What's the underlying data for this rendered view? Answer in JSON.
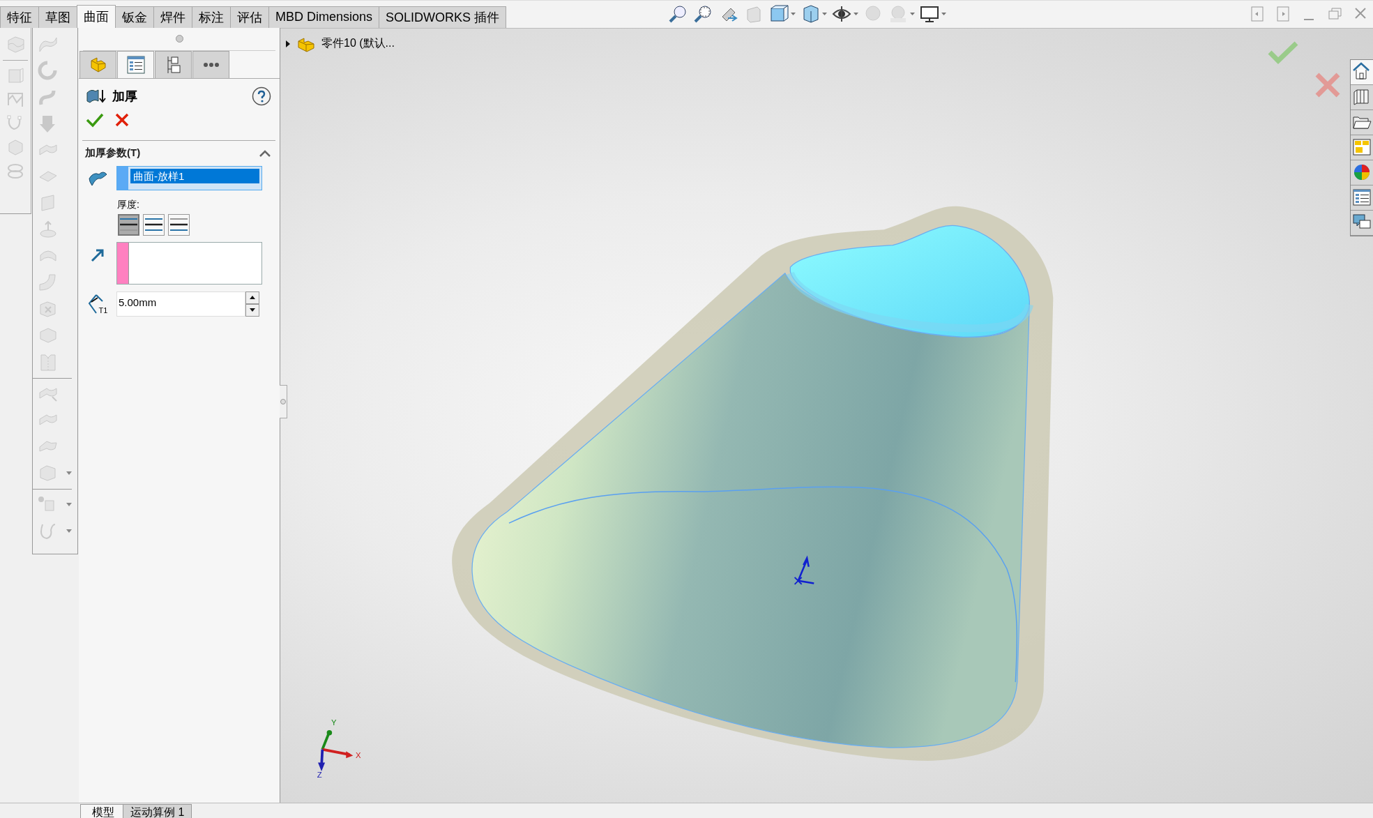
{
  "command_tabs": [
    {
      "label": "特征",
      "selected": false
    },
    {
      "label": "草图",
      "selected": false
    },
    {
      "label": "曲面",
      "selected": true
    },
    {
      "label": "钣金",
      "selected": false
    },
    {
      "label": "焊件",
      "selected": false
    },
    {
      "label": "标注",
      "selected": false
    },
    {
      "label": "评估",
      "selected": false
    },
    {
      "label": "MBD Dimensions",
      "selected": false
    },
    {
      "label": "SOLIDWORKS 插件",
      "selected": false
    }
  ],
  "property_manager": {
    "tabs": [
      {
        "kind": "feature",
        "selected": false
      },
      {
        "kind": "property",
        "selected": true
      },
      {
        "kind": "configuration",
        "selected": false
      },
      {
        "kind": "more",
        "selected": false
      }
    ],
    "title": "加厚",
    "section": {
      "title": "加厚参数(T)",
      "expanded": true
    },
    "selection": {
      "value": "曲面-放样1"
    },
    "thickness_label": "厚度:",
    "side_options": [
      {
        "kind": "side1",
        "selected": true
      },
      {
        "kind": "both",
        "selected": false
      },
      {
        "kind": "side2",
        "selected": false
      }
    ],
    "thickness": {
      "label": "T1",
      "value": "5.00mm"
    }
  },
  "tree": {
    "label": "零件10 (默认...",
    "expanded": false
  },
  "axis_labels": {
    "x": "X",
    "y": "Y",
    "z": "Z"
  },
  "bottom_tabs": [
    {
      "label": "模型",
      "selected": true
    },
    {
      "label": "运动算例 1",
      "selected": false
    }
  ]
}
